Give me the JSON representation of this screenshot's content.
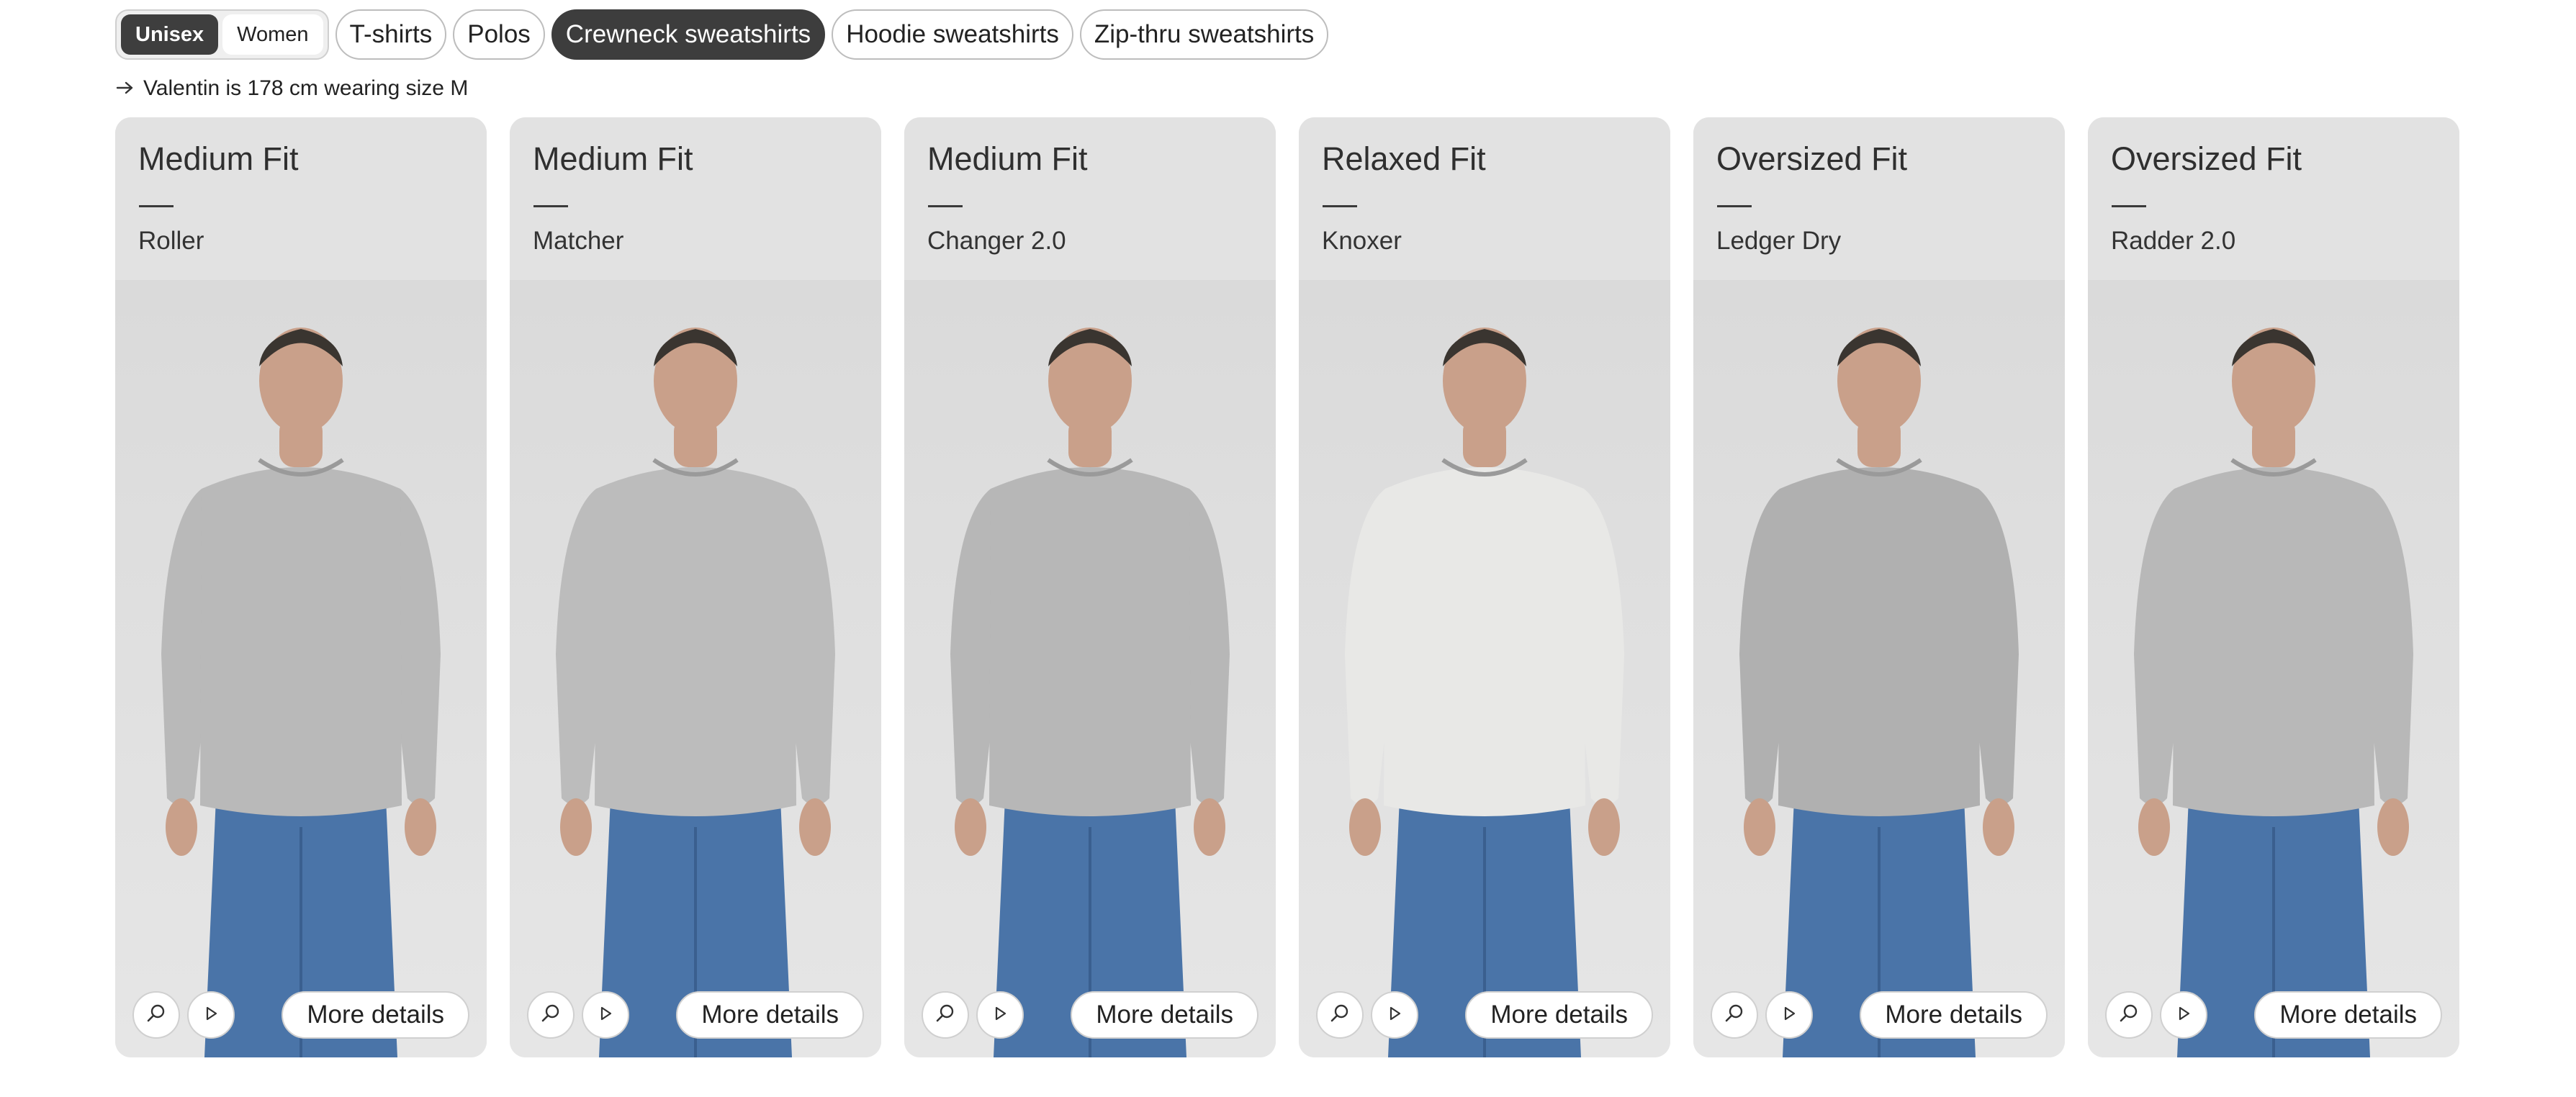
{
  "gender_toggle": [
    {
      "label": "Unisex",
      "active": true
    },
    {
      "label": "Women",
      "active": false
    }
  ],
  "categories": [
    {
      "label": "T-shirts",
      "active": false
    },
    {
      "label": "Polos",
      "active": false
    },
    {
      "label": "Crewneck sweatshirts",
      "active": true
    },
    {
      "label": "Hoodie sweatshirts",
      "active": false
    },
    {
      "label": "Zip-thru sweatshirts",
      "active": false
    }
  ],
  "caption": {
    "icon": "arrow-right-icon",
    "text": "Valentin is 178 cm wearing size M"
  },
  "cards": [
    {
      "fit": "Medium Fit",
      "model": "Roller",
      "sweater_color": "#b9b9b9",
      "more_label": "More details"
    },
    {
      "fit": "Medium Fit",
      "model": "Matcher",
      "sweater_color": "#bcbcbc",
      "more_label": "More details"
    },
    {
      "fit": "Medium Fit",
      "model": "Changer 2.0",
      "sweater_color": "#b7b7b7",
      "more_label": "More details"
    },
    {
      "fit": "Relaxed Fit",
      "model": "Knoxer",
      "sweater_color": "#e8e8e6",
      "more_label": "More details"
    },
    {
      "fit": "Oversized Fit",
      "model": "Ledger Dry",
      "sweater_color": "#b0b0b0",
      "more_label": "More details"
    },
    {
      "fit": "Oversized Fit",
      "model": "Radder 2.0",
      "sweater_color": "#b8b8b8",
      "more_label": "More details"
    }
  ],
  "colors": {
    "active_pill": "#3d3d3d",
    "card_bg": "#e2e2e2",
    "jeans": "#4a74a8",
    "skin": "#c9a08a"
  }
}
